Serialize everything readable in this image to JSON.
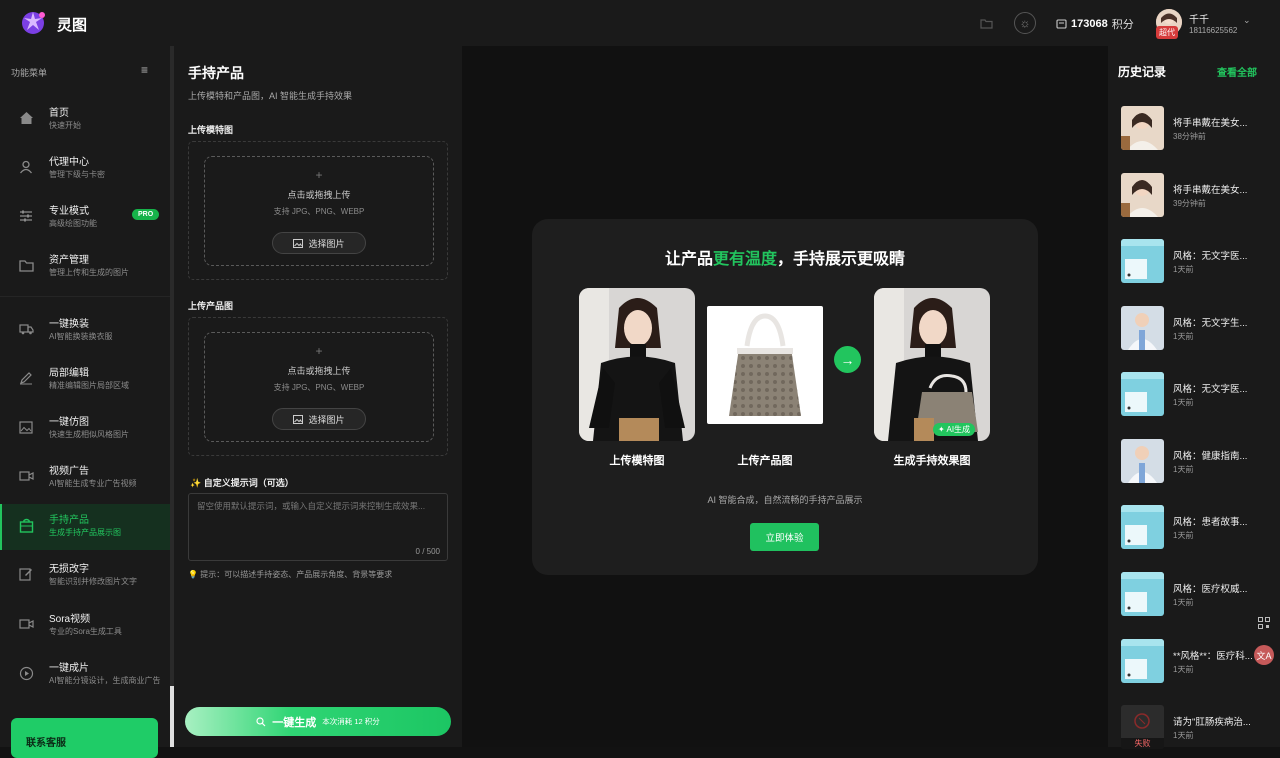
{
  "app": {
    "name": "灵图"
  },
  "topbar": {
    "folder_icon": "folder-icon",
    "theme_icon": "sun-icon",
    "credits_value": "173068",
    "credits_unit": "积分",
    "user_name": "千千",
    "user_phone": "18116625562",
    "vip_label": "超代"
  },
  "sidebar": {
    "header": "功能菜单",
    "items": [
      {
        "title": "首页",
        "sub": "快速开始",
        "icon": "home-icon"
      },
      {
        "title": "代理中心",
        "sub": "管理下级与卡密",
        "icon": "user-icon"
      },
      {
        "title": "专业模式",
        "sub": "高级绘图功能",
        "icon": "sliders-icon",
        "badge": "PRO"
      },
      {
        "title": "资产管理",
        "sub": "管理上传和生成的图片",
        "icon": "folder-icon"
      },
      {
        "title": "一键换装",
        "sub": "AI智能换装换衣服",
        "icon": "truck-icon"
      },
      {
        "title": "局部编辑",
        "sub": "精准编辑图片局部区域",
        "icon": "pencil-icon"
      },
      {
        "title": "一键仿图",
        "sub": "快速生成相似风格图片",
        "icon": "image-icon"
      },
      {
        "title": "视频广告",
        "sub": "AI智能生成专业广告视频",
        "icon": "video-icon"
      },
      {
        "title": "手持产品",
        "sub": "生成手持产品展示图",
        "icon": "bag-icon",
        "active": true
      },
      {
        "title": "无损改字",
        "sub": "智能识别并修改图片文字",
        "icon": "edit-icon"
      },
      {
        "title": "Sora视频",
        "sub": "专业的Sora生成工具",
        "icon": "camera-icon"
      },
      {
        "title": "一键成片",
        "sub": "AI智能分镜设计，生成商业广告",
        "icon": "play-icon"
      }
    ],
    "support": "联系客服"
  },
  "form": {
    "title": "手持产品",
    "desc": "上传模特和产品图，AI 智能生成手持效果",
    "model_label": "上传模特图",
    "product_label": "上传产品图",
    "upload_text": "点击或拖拽上传",
    "upload_hint": "支持 JPG、PNG、WEBP",
    "pick_label": "选择图片",
    "prompt_label": "自定义提示词（可选）",
    "prompt_placeholder": "留空使用默认提示词，或输入自定义提示词来控制生成效果...",
    "prompt_count": "0 / 500",
    "prompt_tip": "提示：可以描述手持姿态、产品展示角度、背景等要求",
    "generate_label": "一键生成",
    "generate_cost": "本次消耗 12 积分"
  },
  "demo": {
    "title_pre": "让产品",
    "title_hl": "更有温度",
    "title_post": "，手持展示更吸睛",
    "cap_model": "上传模特图",
    "cap_product": "上传产品图",
    "cap_result": "生成手持效果图",
    "ai_tag": "AI生成",
    "subtitle": "AI 智能合成，自然流畅的手持产品展示",
    "try_label": "立即体验"
  },
  "history": {
    "title": "历史记录",
    "view_all": "查看全部",
    "items": [
      {
        "name": "将手串戴在美女...",
        "time": "38分钟前",
        "thumb": "portrait"
      },
      {
        "name": "将手串戴在美女...",
        "time": "39分钟前",
        "thumb": "portrait"
      },
      {
        "name": "风格：无文字医...",
        "time": "1天前",
        "thumb": "medical"
      },
      {
        "name": "风格：无文字生...",
        "time": "1天前",
        "thumb": "doctor"
      },
      {
        "name": "风格：无文字医...",
        "time": "1天前",
        "thumb": "medical"
      },
      {
        "name": "风格：健康指南...",
        "time": "1天前",
        "thumb": "doctor"
      },
      {
        "name": "风格：患者故事...",
        "time": "1天前",
        "thumb": "medical"
      },
      {
        "name": "风格：医疗权威...",
        "time": "1天前",
        "thumb": "medical"
      },
      {
        "name": "**风格**：医疗科...",
        "time": "1天前",
        "thumb": "medical"
      },
      {
        "name": "请为\"肛肠疾病治...",
        "time": "1天前",
        "thumb": "failed",
        "status": "失败"
      }
    ]
  }
}
